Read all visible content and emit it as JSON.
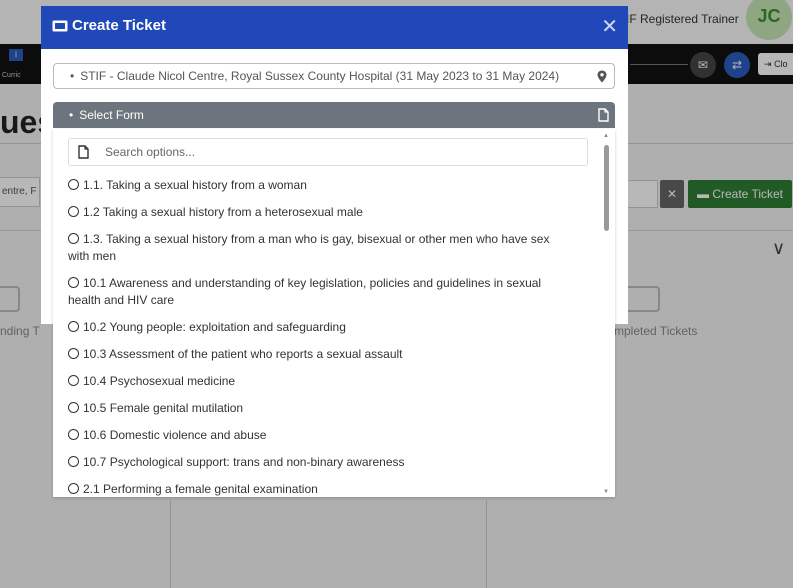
{
  "background": {
    "header_role": "IF Registered Trainer",
    "avatar_initials": "JC",
    "nav_info_icon": "i",
    "nav_curriculum": "Curric",
    "close_button": "Clo",
    "page_title": "ues",
    "filter_text": "entre, F",
    "create_ticket_button": "Create Ticket",
    "pending_label": "nding T",
    "completed_label": "mpleted Tickets"
  },
  "modal": {
    "title": "Create Ticket",
    "location_select": "STIF - Claude Nicol Centre, Royal Sussex County Hospital (31 May 2023 to 31 May 2024)",
    "form_select": "Select Form",
    "search_placeholder": "Search options...",
    "options": [
      "1.1. Taking a sexual history from a woman",
      "1.2 Taking a sexual history from a heterosexual male",
      "1.3. Taking a sexual history from a man who is gay, bisexual or other men who have sex with men",
      "10.1 Awareness and understanding of key legislation, policies and guidelines in sexual health and HIV care",
      "10.2 Young people: exploitation and safeguarding",
      "10.3 Assessment of the patient who reports a sexual assault",
      "10.4 Psychosexual medicine",
      "10.5 Female genital mutilation",
      "10.6 Domestic violence and abuse",
      "10.7 Psychological support: trans and non-binary awareness",
      "2.1 Performing a female genital examination"
    ]
  },
  "colors": {
    "modal_header": "#2148b8",
    "form_select_bg": "#6c757d",
    "create_button": "#2e7d32"
  }
}
